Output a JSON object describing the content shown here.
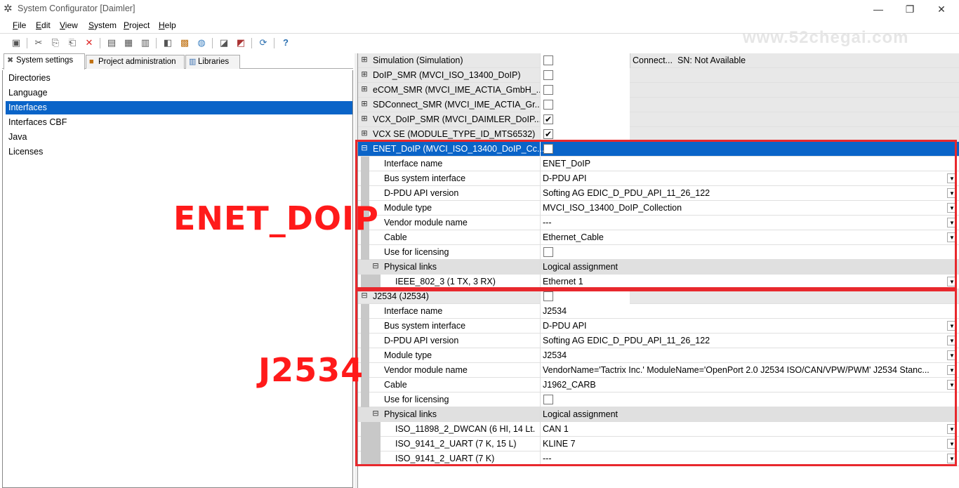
{
  "window": {
    "title": "System Configurator [Daimler]"
  },
  "menu": [
    "File",
    "Edit",
    "View",
    "System",
    "Project",
    "Help"
  ],
  "watermark": "www.52chegai.com",
  "tabs": [
    {
      "label": "System settings",
      "icon": "tools-icon"
    },
    {
      "label": "Project administration",
      "icon": "project-icon"
    },
    {
      "label": "Libraries",
      "icon": "library-icon"
    }
  ],
  "left_items": [
    "Directories",
    "Language",
    "Interfaces",
    "Interfaces CBF",
    "Java",
    "Licenses"
  ],
  "left_selected": "Interfaces",
  "interfaces": [
    {
      "name": "Simulation (Simulation)",
      "checked": false,
      "col3": "Connect...",
      "col4": "SN: Not Available"
    },
    {
      "name": "DoIP_SMR (MVCI_ISO_13400_DoIP)",
      "checked": false
    },
    {
      "name": "eCOM_SMR (MVCI_IME_ACTIA_GmbH_...",
      "checked": false
    },
    {
      "name": "SDConnect_SMR (MVCI_IME_ACTIA_Gr...",
      "checked": false
    },
    {
      "name": "VCX_DoIP_SMR (MVCI_DAIMLER_DoIP...",
      "checked": true
    },
    {
      "name": "VCX SE (MODULE_TYPE_ID_MTS6532)",
      "checked": true
    }
  ],
  "enet": {
    "header": "ENET_DoIP (MVCI_ISO_13400_DoIP_Cc...",
    "props": [
      {
        "label": "Interface name",
        "value": "ENET_DoIP",
        "dropdown": false
      },
      {
        "label": "Bus system interface",
        "value": "D-PDU API",
        "dropdown": true
      },
      {
        "label": "D-PDU API version",
        "value": "Softing AG EDIC_D_PDU_API_11_26_122",
        "dropdown": true
      },
      {
        "label": "Module type",
        "value": "MVCI_ISO_13400_DoIP_Collection",
        "dropdown": true
      },
      {
        "label": "Vendor module name",
        "value": "---",
        "dropdown": true
      },
      {
        "label": "Cable",
        "value": "Ethernet_Cable",
        "dropdown": true
      },
      {
        "label": "Use for licensing",
        "value": "",
        "checkbox": true
      }
    ],
    "links_label": "Physical links",
    "links_value_header": "Logical assignment",
    "links": [
      {
        "label": "IEEE_802_3 (1 TX, 3 RX)",
        "value": "Ethernet 1"
      }
    ]
  },
  "j2534": {
    "header": "J2534 (J2534)",
    "props": [
      {
        "label": "Interface name",
        "value": "J2534",
        "dropdown": false
      },
      {
        "label": "Bus system interface",
        "value": "D-PDU API",
        "dropdown": true
      },
      {
        "label": "D-PDU API version",
        "value": "Softing AG EDIC_D_PDU_API_11_26_122",
        "dropdown": true
      },
      {
        "label": "Module type",
        "value": "J2534",
        "dropdown": true
      },
      {
        "label": "Vendor module name",
        "value": "VendorName='Tactrix Inc.' ModuleName='OpenPort 2.0 J2534 ISO/CAN/VPW/PWM' J2534 Stanc...",
        "dropdown": true
      },
      {
        "label": "Cable",
        "value": "J1962_CARB",
        "dropdown": true
      },
      {
        "label": "Use for licensing",
        "value": "",
        "checkbox": true
      }
    ],
    "links_label": "Physical links",
    "links_value_header": "Logical assignment",
    "links": [
      {
        "label": "ISO_11898_2_DWCAN (6 HI, 14 Lt...",
        "value": "CAN 1"
      },
      {
        "label": "ISO_9141_2_UART (7 K, 15 L)",
        "value": "KLINE 7"
      },
      {
        "label": "ISO_9141_2_UART (7 K)",
        "value": "---"
      }
    ]
  },
  "annotations": {
    "enet": "ENET_DOIP",
    "j2534": "J2534"
  },
  "colors": {
    "selection": "#0a64c8",
    "annotation": "#e8282d"
  }
}
